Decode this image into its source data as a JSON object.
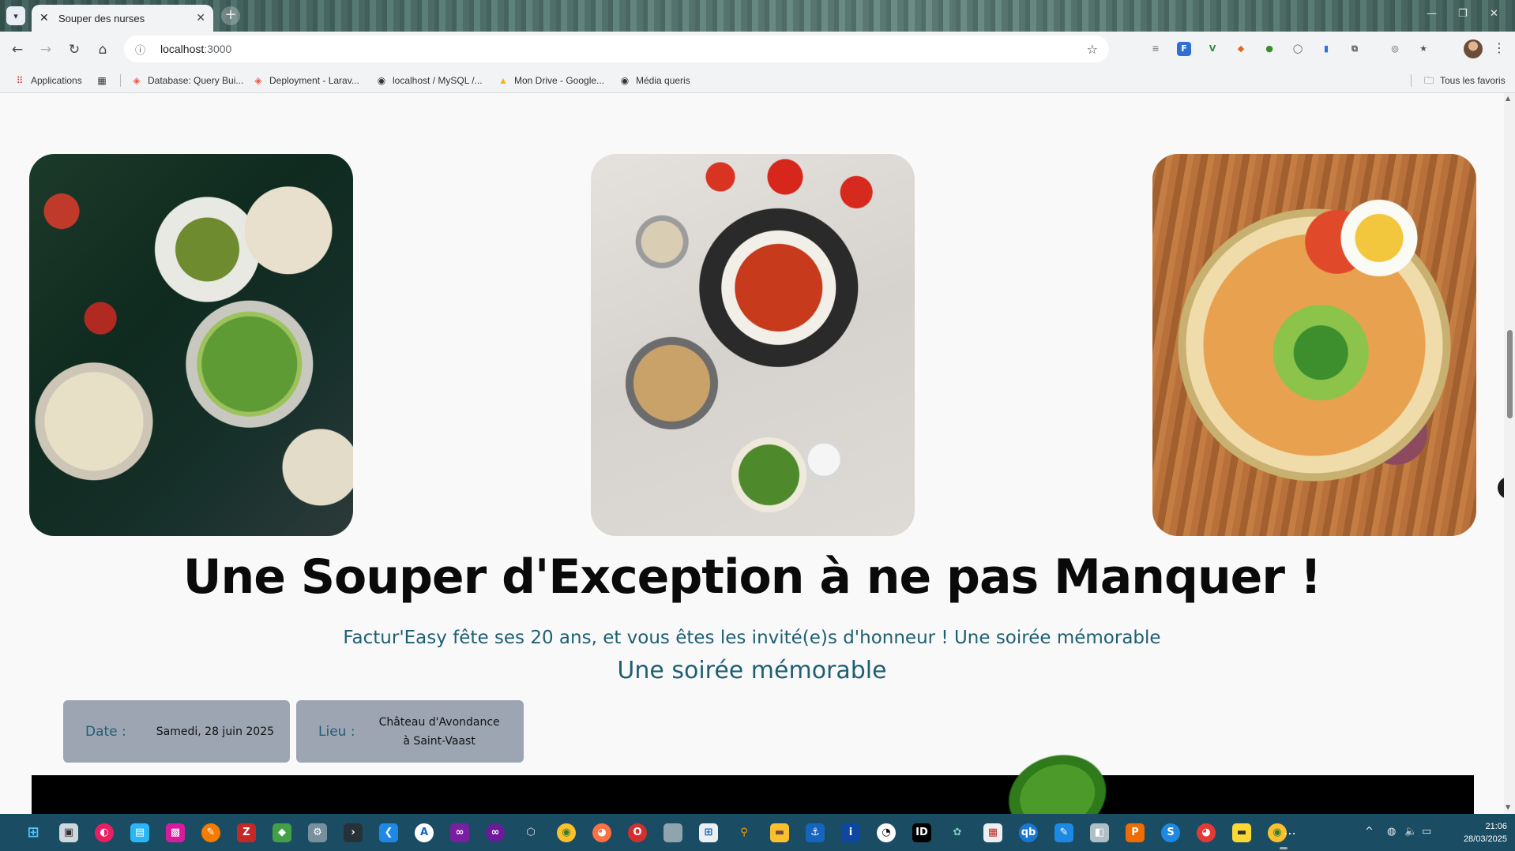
{
  "browser": {
    "tab_title": "Souper des nurses",
    "tab_close": "✕",
    "new_tab": "+",
    "url_host": "localhost",
    "url_port": ":3000",
    "bookmarks": [
      {
        "label": "Applications",
        "icon": "apps-grid-icon"
      },
      {
        "label": "Database: Query Bui...",
        "icon": "laravel-icon"
      },
      {
        "label": "Deployment - Larav...",
        "icon": "laravel-icon"
      },
      {
        "label": "localhost / MySQL /...",
        "icon": "globe-icon"
      },
      {
        "label": "Mon Drive - Google...",
        "icon": "google-drive-icon"
      },
      {
        "label": "Média queris",
        "icon": "globe-icon"
      }
    ],
    "all_bookmarks": "Tous les favoris"
  },
  "hero": {
    "title": "Une Souper d'Exception à ne pas Manquer !",
    "subtitle": "Factur'Easy fête ses 20 ans, et vous êtes les invité(e)s d'honneur ! Une soirée mémorable",
    "subtitle2": "Une soirée mémorable",
    "images": [
      {
        "alt": "Christmas dinner table with soups, salads and brussels sprouts"
      },
      {
        "alt": "Tomato soup with bread, tomatoes and herbs"
      },
      {
        "alt": "Noodle soup bowl with egg, peanuts and greens"
      }
    ]
  },
  "info": {
    "date_label": "Date :",
    "date_value": "Samedi, 28 juin 2025",
    "place_label": "Lieu :",
    "place_line1": "Château d'Avondance",
    "place_line2": "à Saint-Vaast"
  },
  "taskbar": {
    "time": "21:06",
    "date": "28/03/2025"
  },
  "colors": {
    "accent_text": "#1f5f73",
    "card_bg": "#9ea5b2",
    "taskbar_bg": "#1a4d63"
  }
}
